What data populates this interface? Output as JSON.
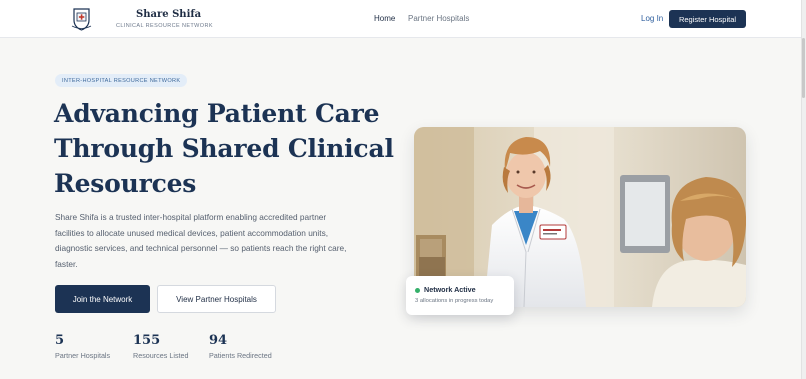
{
  "nav": {
    "brand_name": "Share Shifa",
    "brand_tagline": "CLINICAL RESOURCE NETWORK",
    "links": [
      {
        "label": "Home"
      },
      {
        "label": "Partner Hospitals"
      }
    ],
    "login_label": "Log In",
    "register_label": "Register Hospital"
  },
  "hero": {
    "eyebrow": "INTER-HOSPITAL RESOURCE NETWORK",
    "title_lines": [
      "Advancing Patient Care",
      "Through Shared Clinical",
      "Resources"
    ],
    "description": "Share Shifa is a trusted inter-hospital platform enabling accredited partner facilities to allocate unused medical devices, patient accommodation units, diagnostic services, and technical personnel — so patients reach the right care, faster.",
    "primary_cta": "Join the Network",
    "secondary_cta": "View Partner Hospitals"
  },
  "stats": [
    {
      "value": "5",
      "label": "Partner Hospitals"
    },
    {
      "value": "155",
      "label": "Resources Listed"
    },
    {
      "value": "94",
      "label": "Patients Redirected"
    }
  ],
  "status_card": {
    "title": "Network Active",
    "subtitle": "3 allocations in progress today"
  },
  "colors": {
    "primary": "#1c3354",
    "accent_link": "#2f5f9e",
    "status_green": "#35b06a",
    "eyebrow_bg": "#e3edf8"
  },
  "icons": {
    "logo": "hospital-crest-icon",
    "status": "status-dot-icon"
  }
}
